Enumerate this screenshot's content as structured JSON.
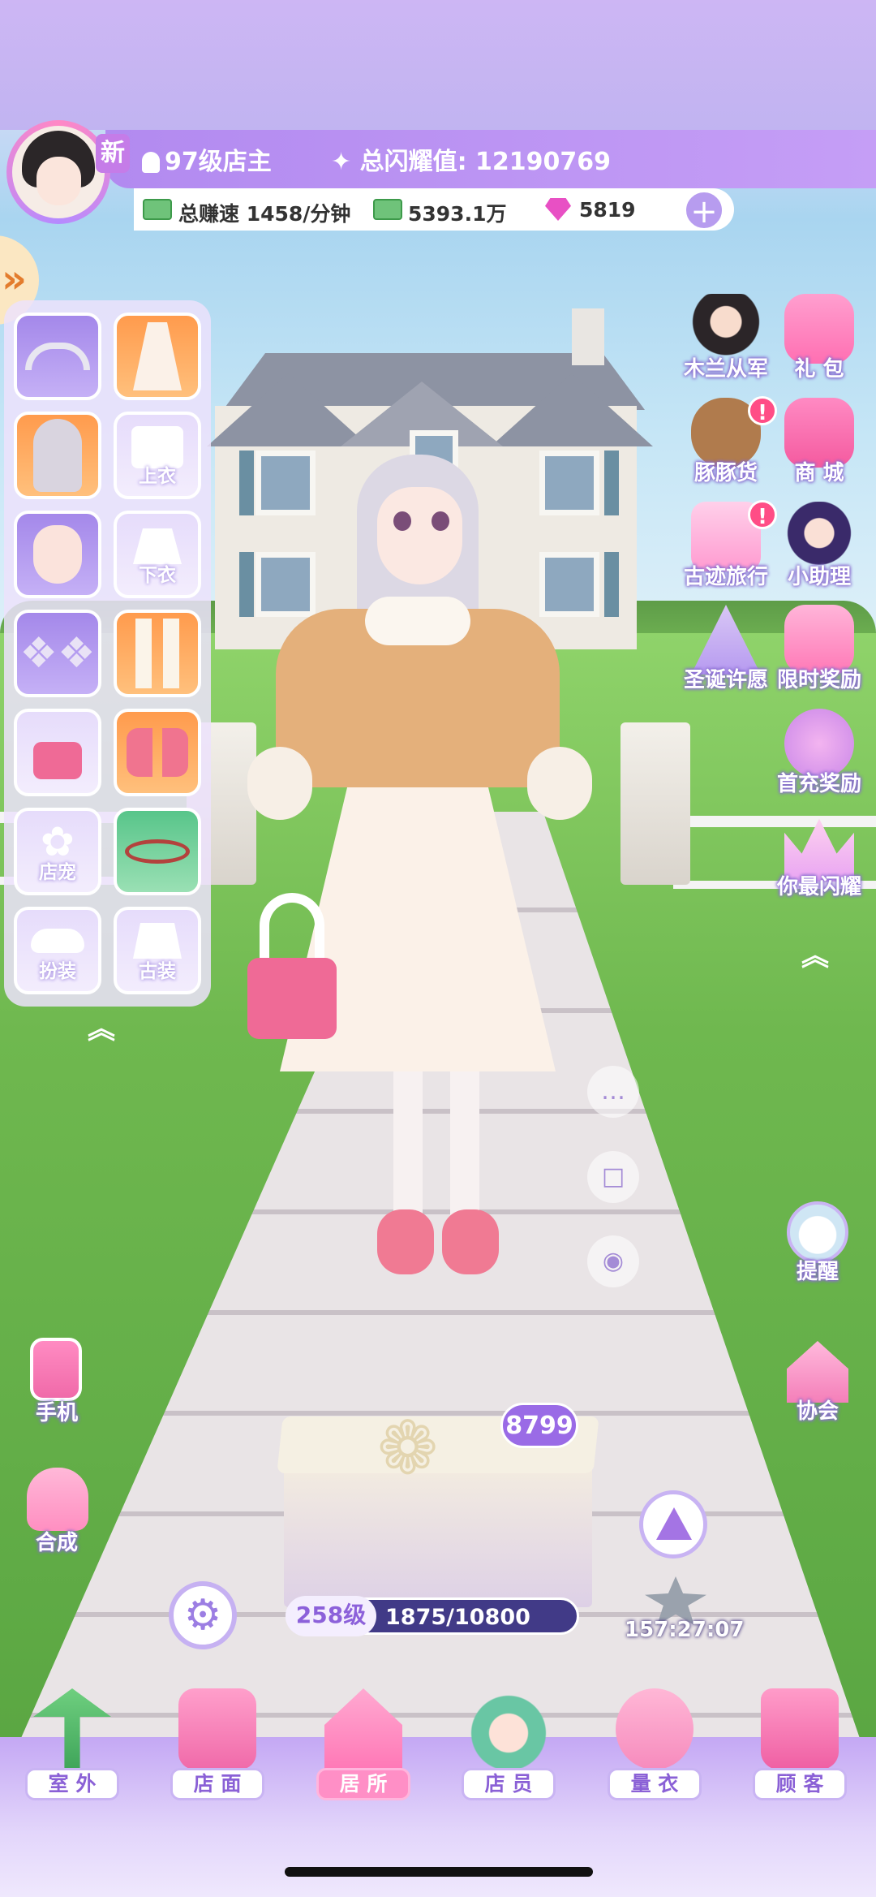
{
  "header": {
    "new_badge": "新",
    "level_text": "97级店主",
    "shine_text": "总闪耀值: 12190769"
  },
  "currency": {
    "earn_rate": "总赚速 1458/分钟",
    "cash": "5393.1万",
    "gems": "5819",
    "add_symbol": "+"
  },
  "side_toggle": "»",
  "wardrobe": {
    "slots": [
      {
        "label": "",
        "item": "headband"
      },
      {
        "label": "",
        "item": "dress"
      },
      {
        "label": "",
        "item": "hair"
      },
      {
        "label": "上衣",
        "item": "top"
      },
      {
        "label": "",
        "item": "face"
      },
      {
        "label": "下衣",
        "item": "bottom"
      },
      {
        "label": "",
        "item": "earrings"
      },
      {
        "label": "",
        "item": "socks"
      },
      {
        "label": "",
        "item": "handbag"
      },
      {
        "label": "",
        "item": "shoes"
      },
      {
        "label": "店宠",
        "item": "pet"
      },
      {
        "label": "",
        "item": "bracelet"
      },
      {
        "label": "扮装",
        "item": "costume"
      },
      {
        "label": "古装",
        "item": "ancient-outfit"
      }
    ],
    "collapse_symbol": "︽"
  },
  "features": [
    {
      "label": "木兰从军",
      "icon": "mulan-icon"
    },
    {
      "label": "礼 包",
      "icon": "gift-pack-icon"
    },
    {
      "label": "豚豚货",
      "icon": "capybara-icon",
      "alert": "!"
    },
    {
      "label": "商 城",
      "icon": "shop-icon"
    },
    {
      "label": "古迹旅行",
      "icon": "bus-icon",
      "alert": "!"
    },
    {
      "label": "小助理",
      "icon": "assistant-icon"
    },
    {
      "label": "圣诞许愿",
      "icon": "christmas-tree-icon"
    },
    {
      "label": "限时奖励",
      "icon": "gift-box-icon"
    },
    {
      "label": "首充奖励",
      "icon": "balloon-icon"
    },
    {
      "label": "你最闪耀",
      "icon": "crown-icon"
    }
  ],
  "feature_collapse": "︽",
  "actions": {
    "chat": "…",
    "box": "□",
    "camera": "◉"
  },
  "tools": {
    "phone": "手机",
    "compose": "合成",
    "remind": "提醒",
    "guild": "协会"
  },
  "gift": {
    "count": "8799",
    "level": "258级",
    "progress_text": "1875/10800",
    "progress_fraction": 0.1736,
    "timer": "157:27:07"
  },
  "nav": [
    {
      "label": "室 外",
      "icon": "palm-tree-icon"
    },
    {
      "label": "店 面",
      "icon": "storefront-icon"
    },
    {
      "label": "居 所",
      "icon": "house-icon",
      "active": true
    },
    {
      "label": "店 员",
      "icon": "staff-icon"
    },
    {
      "label": "量 衣",
      "icon": "tape-measure-icon"
    },
    {
      "label": "顾 客",
      "icon": "shopping-bag-icon"
    }
  ],
  "colors": {
    "accent_purple": "#a488ea",
    "accent_orange": "#ff9b4d",
    "progress_fill": "#55b5ff",
    "alert_pink": "#ff4d86"
  }
}
